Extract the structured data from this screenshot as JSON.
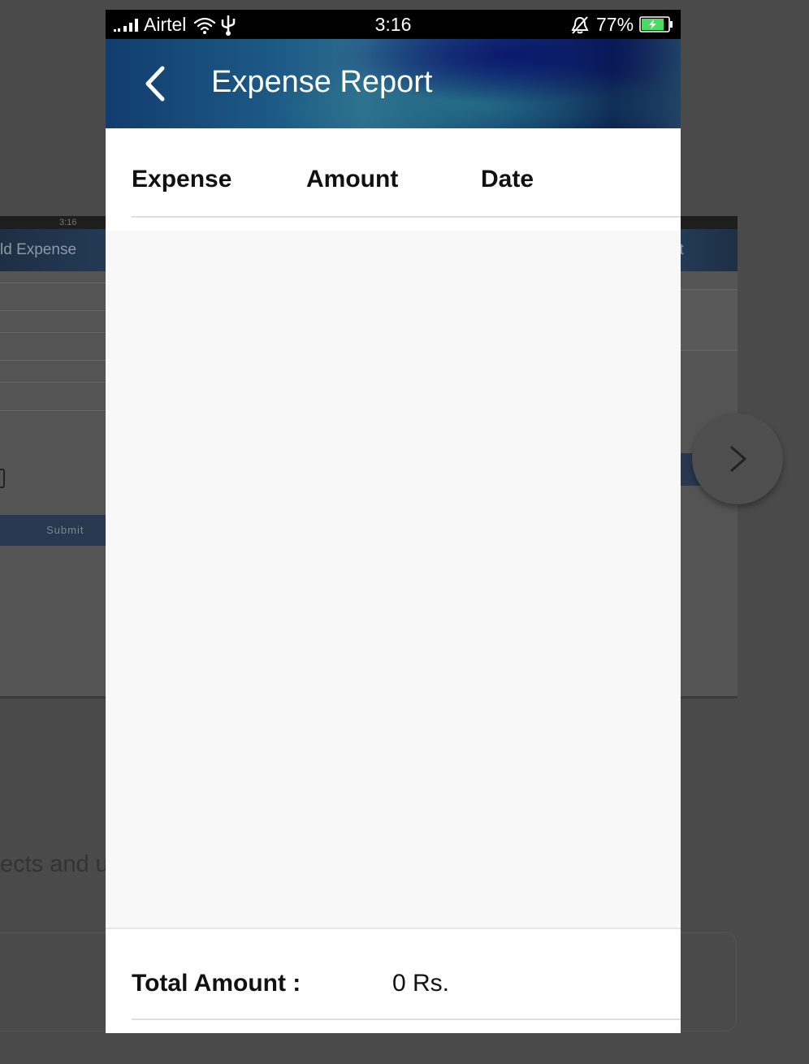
{
  "background": {
    "left_screen": {
      "status_time": "3:16",
      "header_title_fragment": "ld Expense",
      "submit_label": "Submit"
    },
    "right_screen": {
      "header_title_fragment": "rt"
    },
    "text_fragment": "ects and us"
  },
  "status_bar": {
    "carrier": "Airtel",
    "time": "3:16",
    "battery_percent": "77%"
  },
  "app_bar": {
    "title": "Expense Report"
  },
  "table": {
    "columns": [
      "Expense",
      "Amount",
      "Date"
    ],
    "rows": []
  },
  "footer": {
    "total_label": "Total Amount :",
    "total_value": "0 Rs."
  },
  "colors": {
    "app_bar_start": "#123d6e",
    "app_bar_end": "#0a1a4a",
    "battery_fill": "#4cd964"
  }
}
